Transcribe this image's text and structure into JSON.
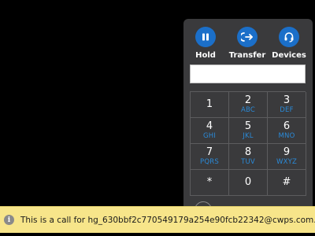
{
  "call_panel": {
    "actions": [
      {
        "label": "Hold",
        "icon": "pause-icon"
      },
      {
        "label": "Transfer",
        "icon": "transfer-icon"
      },
      {
        "label": "Devices",
        "icon": "headset-icon"
      }
    ],
    "dial_input": {
      "value": "",
      "placeholder": ""
    },
    "keypad": [
      {
        "digit": "1",
        "letters": ""
      },
      {
        "digit": "2",
        "letters": "ABC"
      },
      {
        "digit": "3",
        "letters": "DEF"
      },
      {
        "digit": "4",
        "letters": "GHI"
      },
      {
        "digit": "5",
        "letters": "JKL"
      },
      {
        "digit": "6",
        "letters": "MNO"
      },
      {
        "digit": "7",
        "letters": "PQRS"
      },
      {
        "digit": "8",
        "letters": "TUV"
      },
      {
        "digit": "9",
        "letters": "WXYZ"
      },
      {
        "digit": "*",
        "letters": ""
      },
      {
        "digit": "0",
        "letters": ""
      },
      {
        "digit": "#",
        "letters": ""
      }
    ]
  },
  "notification": {
    "icon": "info-icon",
    "text": "This is a call for hg_630bbf2c770549179a254e90fcb22342@cwps.com."
  },
  "colors": {
    "panel_background": "#3a3a3c",
    "action_button": "#1b6fc9",
    "keypad_letters": "#2a8ad8",
    "notification_background": "#f7e58a",
    "desktop_background": "#000000"
  }
}
